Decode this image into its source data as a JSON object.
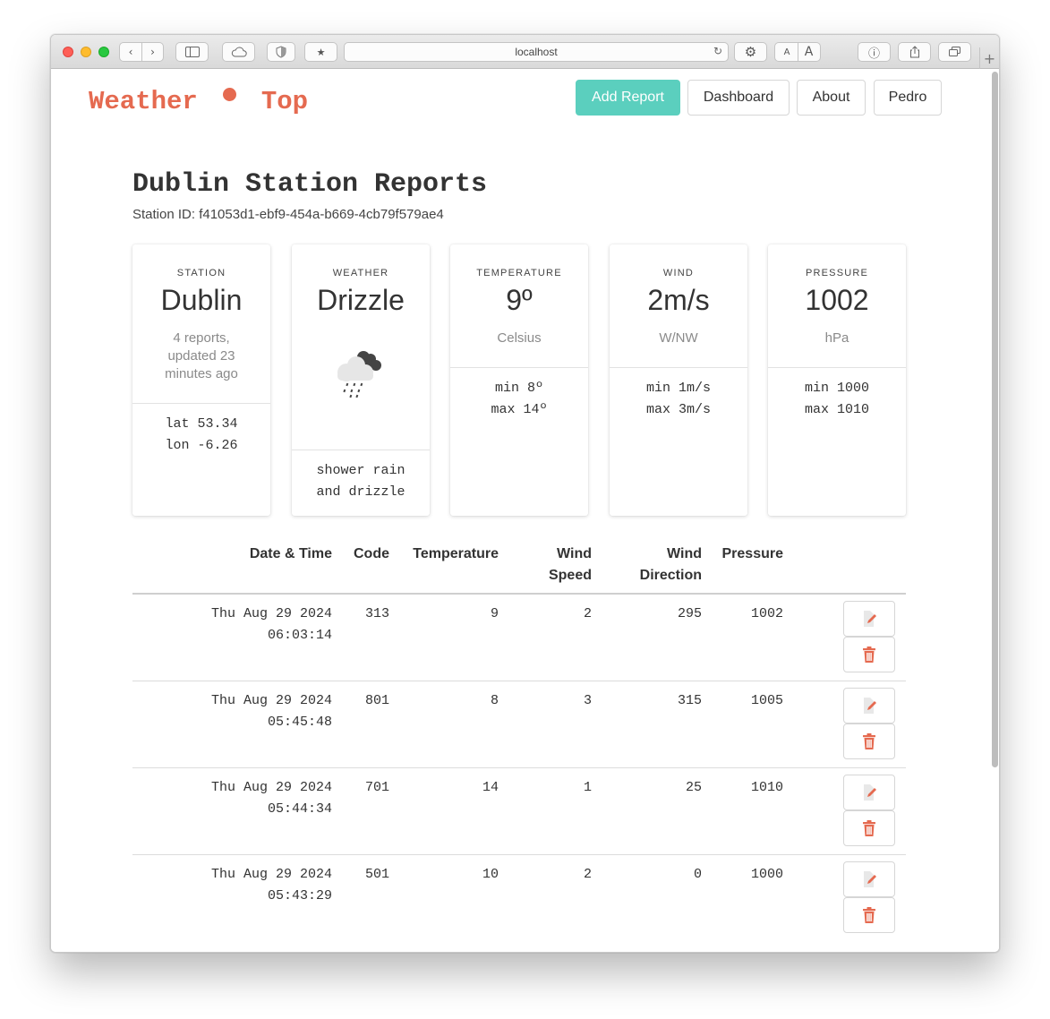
{
  "browser": {
    "url": "localhost"
  },
  "app": {
    "logo_left": "Weather",
    "logo_right": "Top",
    "brand_color": "#e56a50",
    "accent_color": "#5bcfbe"
  },
  "nav": {
    "add_report": "Add Report",
    "dashboard": "Dashboard",
    "about": "About",
    "user": "Pedro"
  },
  "page": {
    "title": "Dublin Station Reports",
    "station_id": "Station ID: f41053d1-ebf9-454a-b669-4cb79f579ae4"
  },
  "cards": {
    "station": {
      "label": "STATION",
      "value": "Dublin",
      "sub": "4 reports, updated 23 minutes ago",
      "lat": "lat 53.34",
      "lon": "lon -6.26"
    },
    "weather": {
      "label": "WEATHER",
      "value": "Drizzle",
      "icon": "cloud-drizzle-icon",
      "desc1": "shower rain",
      "desc2": "and drizzle"
    },
    "temperature": {
      "label": "TEMPERATURE",
      "value": "9º",
      "unit": "Celsius",
      "min": "min 8º",
      "max": "max 14º"
    },
    "wind": {
      "label": "WIND",
      "value": "2m/s",
      "unit": "W/NW",
      "min": "min 1m/s",
      "max": "max 3m/s"
    },
    "pressure": {
      "label": "PRESSURE",
      "value": "1002",
      "unit": "hPa",
      "min": "min 1000",
      "max": "max 1010"
    }
  },
  "table": {
    "headers": {
      "datetime": "Date & Time",
      "code": "Code",
      "temperature": "Temperature",
      "wind_speed_1": "Wind",
      "wind_speed_2": "Speed",
      "wind_dir_1": "Wind",
      "wind_dir_2": "Direction",
      "pressure": "Pressure"
    },
    "rows": [
      {
        "date": "Thu Aug 29 2024",
        "time": "06:03:14",
        "code": "313",
        "temperature": "9",
        "wind_speed": "2",
        "wind_direction": "295",
        "pressure": "1002"
      },
      {
        "date": "Thu Aug 29 2024",
        "time": "05:45:48",
        "code": "801",
        "temperature": "8",
        "wind_speed": "3",
        "wind_direction": "315",
        "pressure": "1005"
      },
      {
        "date": "Thu Aug 29 2024",
        "time": "05:44:34",
        "code": "701",
        "temperature": "14",
        "wind_speed": "1",
        "wind_direction": "25",
        "pressure": "1010"
      },
      {
        "date": "Thu Aug 29 2024",
        "time": "05:43:29",
        "code": "501",
        "temperature": "10",
        "wind_speed": "2",
        "wind_direction": "0",
        "pressure": "1000"
      }
    ],
    "action_icons": [
      "edit-icon",
      "trash-icon"
    ]
  }
}
